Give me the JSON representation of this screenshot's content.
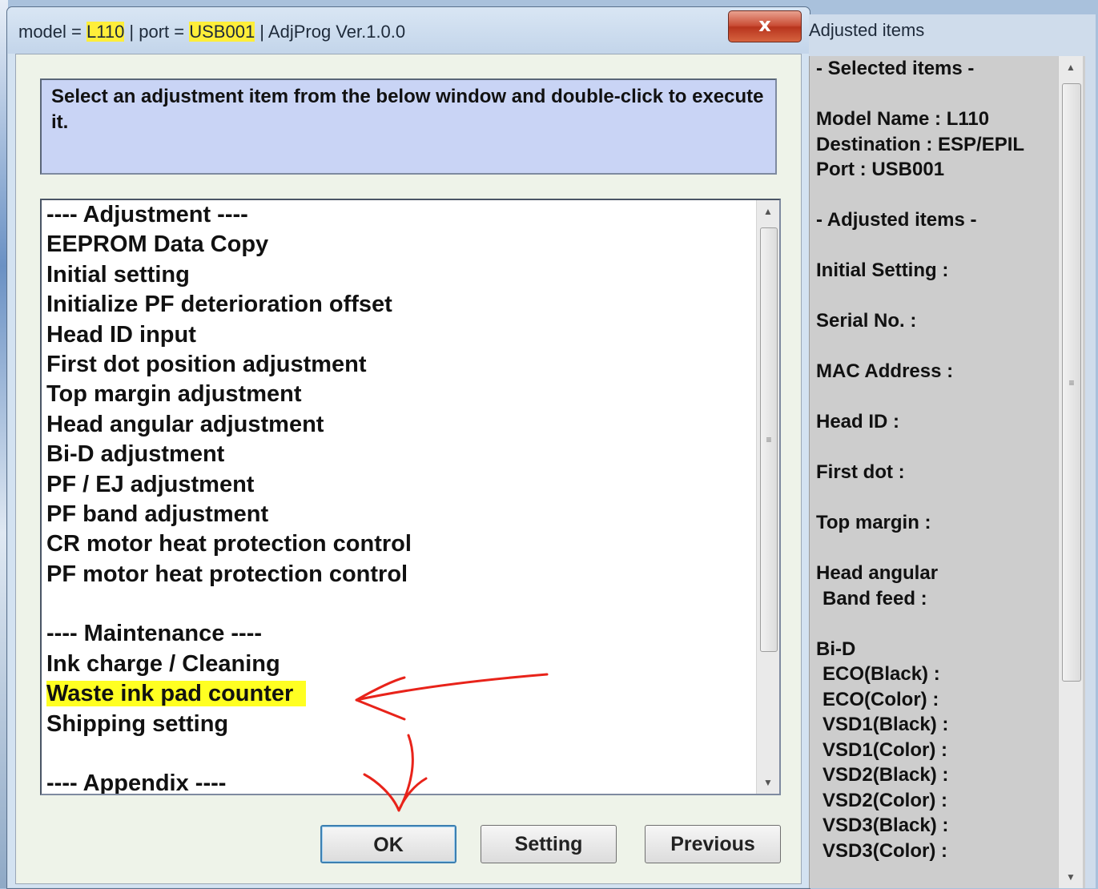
{
  "main_window": {
    "title": {
      "model_label": "model = ",
      "model": "L110",
      "port_label": " | port = ",
      "port": "USB001",
      "rest": " | AdjProg Ver.1.0.0"
    },
    "close_glyph": "x",
    "instruction": "Select an adjustment item from the below window and double-click to execute it.",
    "list_items": [
      "---- Adjustment ----",
      "EEPROM Data Copy",
      "Initial setting",
      "Initialize PF deterioration offset",
      "Head ID input",
      "First dot position adjustment",
      "Top margin adjustment",
      "Head angular adjustment",
      "Bi-D adjustment",
      "PF / EJ adjustment",
      "PF band adjustment",
      "CR motor heat protection control",
      "PF motor heat protection control",
      "",
      "---- Maintenance ----",
      "Ink charge / Cleaning",
      "Waste ink pad counter",
      "Shipping setting",
      "",
      "---- Appendix ----"
    ],
    "highlighted_item": "Waste ink pad counter",
    "buttons": {
      "ok": "OK",
      "setting": "Setting",
      "previous": "Previous"
    }
  },
  "side_window": {
    "title": "Adjusted items",
    "lines": [
      "- Selected items -",
      "",
      "Model Name : L110",
      "Destination : ESP/EPIL",
      "Port : USB001",
      "",
      "- Adjusted items -",
      "",
      "Initial Setting :",
      "",
      "Serial No. :",
      "",
      "MAC Address :",
      "",
      "Head ID :",
      "",
      "First dot :",
      "",
      "Top margin :",
      "",
      "Head angular",
      " Band feed :",
      "",
      "Bi-D",
      " ECO(Black)  :",
      " ECO(Color)  :",
      " VSD1(Black) :",
      " VSD1(Color) :",
      " VSD2(Black) :",
      " VSD2(Color) :",
      " VSD3(Black) :",
      " VSD3(Color) :"
    ]
  },
  "colors": {
    "highlight_yellow": "#ffff22",
    "annotation_red": "#e8231a"
  }
}
